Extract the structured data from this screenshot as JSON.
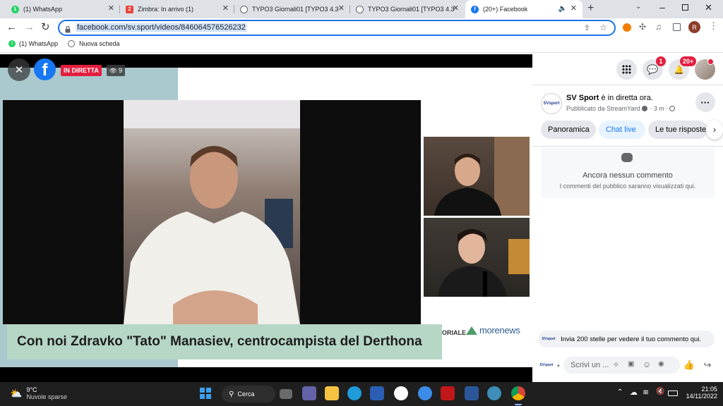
{
  "browser": {
    "tabs": [
      {
        "label": "(1) WhatsApp",
        "icon": "whatsapp-icon",
        "color": "#25d366",
        "glyph": "1"
      },
      {
        "label": "Zimbra: In arrivo (1)",
        "icon": "zimbra-icon",
        "color": "#e8453c",
        "glyph": "Z"
      },
      {
        "label": "TYPO3 Giornali01 [TYPO3 4.3",
        "icon": "globe-icon",
        "color": "#5f6368",
        "glyph": ""
      },
      {
        "label": "TYPO3 Giornali01 [TYPO3 4.3",
        "icon": "globe-icon",
        "color": "#5f6368",
        "glyph": ""
      },
      {
        "label": "(20+) Facebook",
        "icon": "facebook-icon",
        "color": "#1877f2",
        "glyph": "f"
      }
    ],
    "new_tab": "+",
    "url": "facebook.com/sv.sport/videos/846064576526232",
    "profile_initial": "R",
    "bookmarks": [
      {
        "label": "(1) WhatsApp",
        "icon": "whatsapp-icon"
      },
      {
        "label": "Nuova scheda",
        "icon": "globe-icon"
      }
    ]
  },
  "video": {
    "close": "✕",
    "live_label": "IN DIRETTA",
    "viewers": "9",
    "caption": "Con noi Zdravko \"Tato\" Manasiev, centrocampista del Derthona",
    "sponsor_text": "ORIALE",
    "brand_text": "morenews"
  },
  "header": {
    "messenger_badge": "1",
    "notifications_badge": "20+"
  },
  "post": {
    "page_name": "SV Sport",
    "status": " è in diretta ora.",
    "meta": "Pubblicato da StreamYard",
    "time": "· 3 m ·",
    "avatar_text": "SVsport"
  },
  "tabs": [
    {
      "label": "Panoramica",
      "active": false
    },
    {
      "label": "Chat live",
      "active": true
    },
    {
      "label": "Le tue risposte",
      "active": false
    }
  ],
  "comments": {
    "empty_title": "Ancora nessun commento",
    "empty_subtitle": "I commenti del pubblico saranno visualizzati qui.",
    "stars_prompt": "Invia 200 stelle per vedere il tuo commento qui.",
    "input_placeholder": "Scrivi un ..."
  },
  "taskbar": {
    "temperature": "9°C",
    "weather": "Nuvole sparse",
    "search": "Cerca",
    "time": "21:05",
    "date": "14/11/2022"
  }
}
